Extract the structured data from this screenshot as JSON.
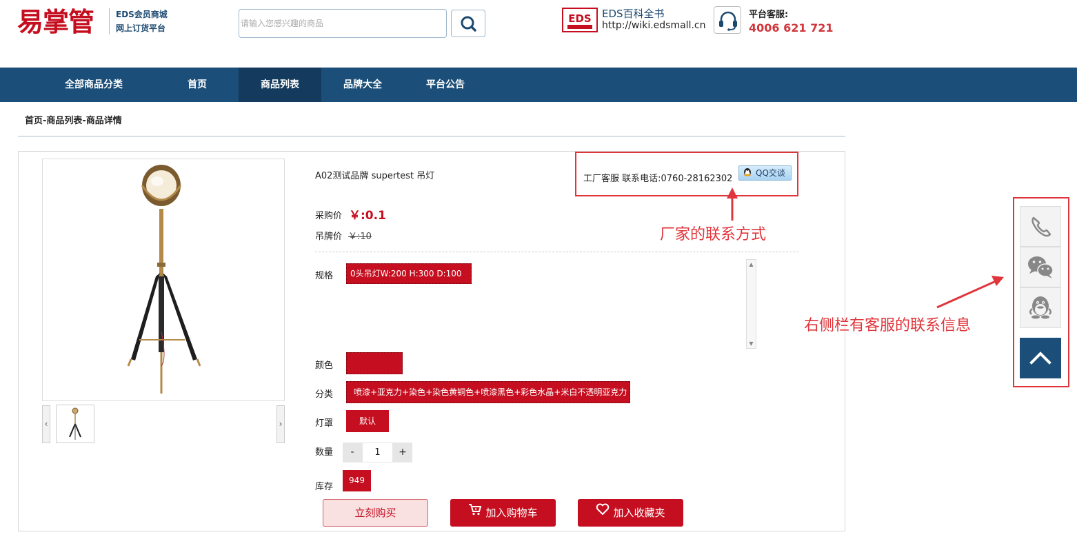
{
  "header": {
    "logo_text": "易掌管",
    "logo_sub1": "EDS会员商城",
    "logo_sub2": "网上订货平台",
    "search_placeholder": "请输入您感兴趣的商品",
    "eds_title": "EDS百科全书",
    "eds_url": "http://wiki.edsmall.cn",
    "service_label": "平台客服:",
    "service_phone": "4006 621 721"
  },
  "nav": {
    "items": [
      {
        "label": "全部商品分类"
      },
      {
        "label": "首页"
      },
      {
        "label": "商品列表"
      },
      {
        "label": "品牌大全"
      },
      {
        "label": "平台公告"
      }
    ]
  },
  "breadcrumb": "首页-商品列表-商品详情",
  "product": {
    "title": "A02测试品牌 supertest 吊灯",
    "factory_contact": "工厂客服 联系电话:0760-28162302",
    "qq_label": "QQ交谈",
    "price_label": "采购价",
    "price_value": "￥:0.1",
    "tag_label": "吊牌价",
    "tag_value": "￥:10",
    "spec_label": "规格",
    "spec_option": "0头吊灯W:200 H:300 D:100",
    "color_label": "颜色",
    "category_label": "分类",
    "category_option": "喷漆+亚克力+染色+染色黄铜色+喷漆黑色+彩色水晶+米白不透明亚克力",
    "shade_label": "灯罩",
    "shade_option": "默认",
    "qty_label": "数量",
    "qty_minus": "-",
    "qty_value": "1",
    "qty_plus": "+",
    "stock_label": "库存",
    "stock_value": "949",
    "btn_buy": "立刻购买",
    "btn_cart": "加入购物车",
    "btn_fav": "加入收藏夹"
  },
  "annotations": {
    "factory_note": "厂家的联系方式",
    "sidebar_note": "右侧栏有客服的联系信息"
  },
  "colors": {
    "brand_red": "#c50e1f",
    "nav_blue": "#1b4e78",
    "annotation_red": "#e0353b"
  },
  "icons": [
    "search-icon",
    "eds-logo-icon",
    "headset-icon",
    "qq-icon",
    "cart-icon",
    "heart-icon",
    "phone-icon",
    "wechat-icon",
    "qq-penguin-icon",
    "chevron-up-icon"
  ]
}
